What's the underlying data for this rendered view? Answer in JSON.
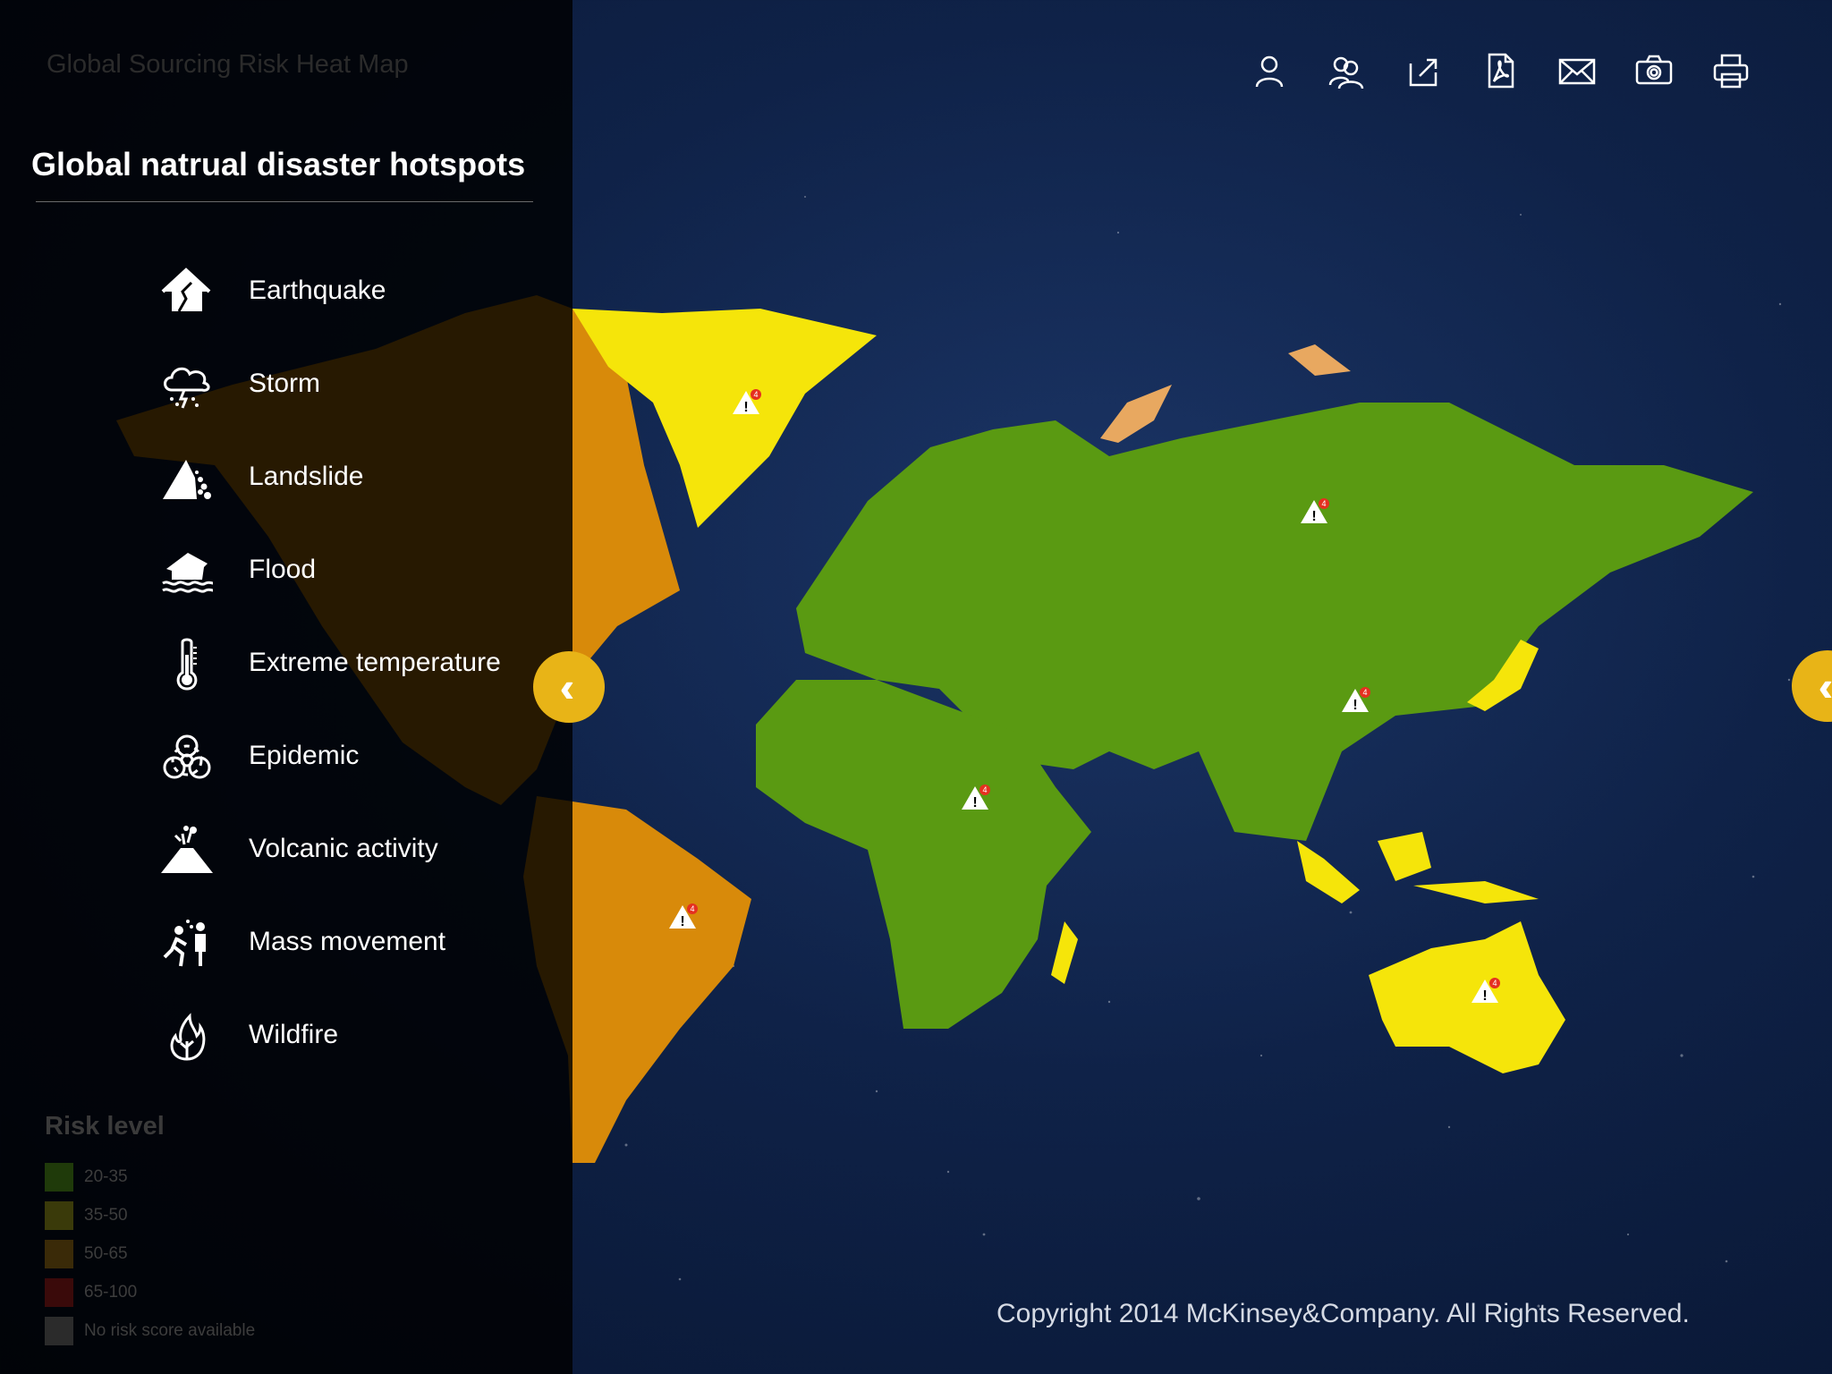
{
  "app_title": "Global Sourcing Risk Heat Map",
  "panel": {
    "heading": "Global natrual disaster hotspots",
    "hazards": [
      {
        "label": "Earthquake",
        "icon": "earthquake-icon"
      },
      {
        "label": "Storm",
        "icon": "storm-icon"
      },
      {
        "label": "Landslide",
        "icon": "landslide-icon"
      },
      {
        "label": "Flood",
        "icon": "flood-icon"
      },
      {
        "label": "Extreme temperature",
        "icon": "thermometer-icon"
      },
      {
        "label": "Epidemic",
        "icon": "biohazard-icon"
      },
      {
        "label": "Volcanic activity",
        "icon": "volcano-icon"
      },
      {
        "label": "Mass movement",
        "icon": "mass-movement-icon"
      },
      {
        "label": "Wildfire",
        "icon": "wildfire-icon"
      }
    ]
  },
  "legend": {
    "title": "Risk level",
    "items": [
      {
        "label": "20-35",
        "color": "#1f3a0a"
      },
      {
        "label": "35-50",
        "color": "#3a3a0a"
      },
      {
        "label": "50-65",
        "color": "#3a2a08"
      },
      {
        "label": "65-100",
        "color": "#3a0a0a"
      },
      {
        "label": "No risk score available",
        "color": "#2b2b2b"
      }
    ]
  },
  "toolbar": [
    "user-icon",
    "users-icon",
    "share-icon",
    "pdf-icon",
    "mail-icon",
    "camera-icon",
    "print-icon"
  ],
  "colors": {
    "green": "#5a9a12",
    "yellow": "#f5e50a",
    "orange": "#d88a0a",
    "light_orange": "#e8a860",
    "accent": "#e8b417"
  },
  "alert_badge": "4",
  "copyright": "Copyright 2014 McKinsey&Company. All Rights Reserved."
}
